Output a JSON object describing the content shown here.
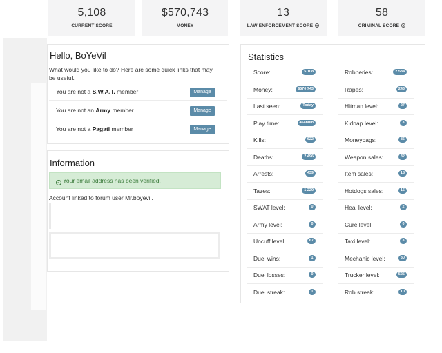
{
  "top_stats": [
    {
      "value": "5,108",
      "label": "CURRENT SCORE"
    },
    {
      "value": "$570,743",
      "label": "MONEY"
    },
    {
      "value": "13",
      "label": "LAW ENFORCEMENT SCORE"
    },
    {
      "value": "58",
      "label": "CRIMINAL SCORE"
    }
  ],
  "greeting": {
    "title": "Hello, BoYeVil",
    "text": "What would you like to do? Here are some quick links that may be useful.",
    "members": [
      {
        "prefix": "You are not a ",
        "group": "S.W.A.T.",
        "suffix": " member",
        "button": "Manage"
      },
      {
        "prefix": "You are not an ",
        "group": "Army",
        "suffix": " member",
        "button": "Manage"
      },
      {
        "prefix": "You are not a ",
        "group": "Pagati",
        "suffix": " member",
        "button": "Manage"
      }
    ]
  },
  "information": {
    "title": "Information",
    "verified": "Your email address has been verified.",
    "linked": "Account linked to forum user Mr.boyevil."
  },
  "statistics": {
    "title": "Statistics",
    "left": [
      {
        "name": "Score:",
        "value": "5 108"
      },
      {
        "name": "Money:",
        "value": "$570 743"
      },
      {
        "name": "Last seen:",
        "value": "Today"
      },
      {
        "name": "Play time:",
        "value": "464h0m"
      },
      {
        "name": "Kills:",
        "value": "622"
      },
      {
        "name": "Deaths:",
        "value": "2 496"
      },
      {
        "name": "Arrests:",
        "value": "439"
      },
      {
        "name": "Tazes:",
        "value": "1 229"
      },
      {
        "name": "SWAT level:",
        "value": "0"
      },
      {
        "name": "Army level:",
        "value": "0"
      },
      {
        "name": "Uncuff level:",
        "value": "67"
      },
      {
        "name": "Duel wins:",
        "value": "1"
      },
      {
        "name": "Duel losses:",
        "value": "0"
      },
      {
        "name": "Duel streak:",
        "value": "1"
      }
    ],
    "right": [
      {
        "name": "Robberies:",
        "value": "2 584"
      },
      {
        "name": "Rapes:",
        "value": "243"
      },
      {
        "name": "Hitman level:",
        "value": "27"
      },
      {
        "name": "Kidnap level:",
        "value": "3"
      },
      {
        "name": "Moneybags:",
        "value": "86"
      },
      {
        "name": "Weapon sales:",
        "value": "32"
      },
      {
        "name": "Item sales:",
        "value": "18"
      },
      {
        "name": "Hotdogs sales:",
        "value": "15"
      },
      {
        "name": "Heal level:",
        "value": "2"
      },
      {
        "name": "Cure level:",
        "value": "0"
      },
      {
        "name": "Taxi level:",
        "value": "3"
      },
      {
        "name": "Mechanic level:",
        "value": "30"
      },
      {
        "name": "Trucker level:",
        "value": "525"
      },
      {
        "name": "Rob streak:",
        "value": "10"
      }
    ]
  }
}
